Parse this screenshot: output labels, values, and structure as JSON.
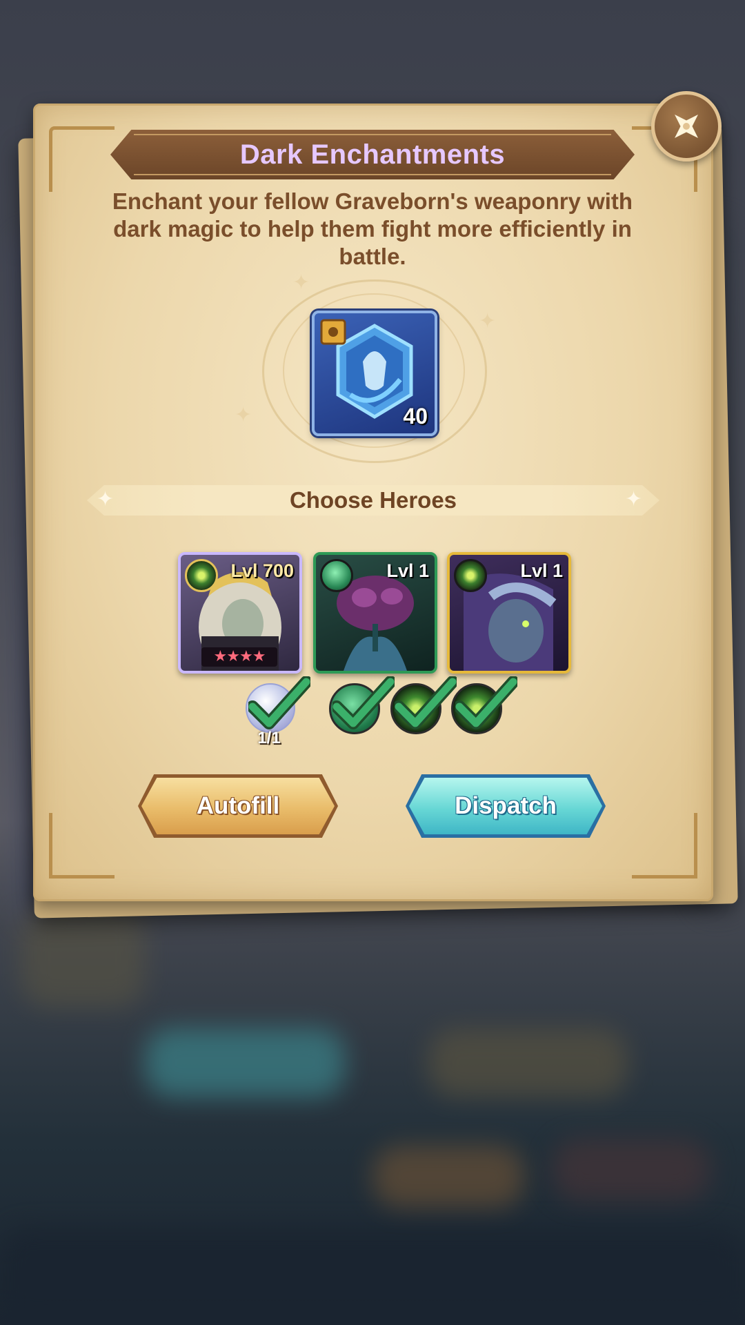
{
  "dialog": {
    "title": "Dark Enchantments",
    "description": "Enchant your fellow Graveborn's weaponry with dark magic to help them fight more efficiently in battle.",
    "close_icon": "close-icon"
  },
  "reward": {
    "icon": "graveborn-emblem-icon",
    "count": "40"
  },
  "choose_heroes": {
    "label": "Choose Heroes"
  },
  "heroes": [
    {
      "level": "Lvl 700",
      "faction": "graveborn",
      "border_color": "#c9b8ff",
      "stars": "★★★★"
    },
    {
      "level": "Lvl 1",
      "faction": "wilder",
      "border_color": "#2e9a56"
    },
    {
      "level": "Lvl 1",
      "faction": "graveborn",
      "border_color": "#e6b93a"
    }
  ],
  "requirements": {
    "crystal_count": "1/1",
    "items": [
      {
        "type": "ascension-crystal",
        "met": true
      },
      {
        "type": "wilder-faction",
        "met": true
      },
      {
        "type": "graveborn-faction",
        "met": true
      },
      {
        "type": "graveborn-faction",
        "met": true
      }
    ]
  },
  "buttons": {
    "autofill_label": "Autofill",
    "dispatch_label": "Dispatch"
  },
  "colors": {
    "title": "#e6c8ff",
    "description": "#7a4e2b",
    "check": "#3bb06a"
  }
}
